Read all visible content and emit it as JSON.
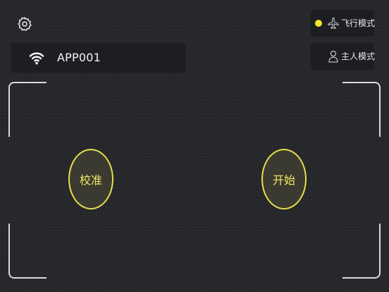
{
  "colors": {
    "background": "#27282b",
    "panel": "#1d1e21",
    "accent_yellow": "#e6e04a",
    "button_text": "#f3e866",
    "frame": "#d9dadc"
  },
  "settings": {
    "icon": "gear-icon"
  },
  "connection": {
    "icon": "wifi-icon",
    "ssid": "APP001"
  },
  "modes": [
    {
      "label": "飞行模式",
      "icon": "airplane-icon",
      "selected": true,
      "indicator_color": "#f2e62d"
    },
    {
      "label": "主人模式",
      "icon": "person-icon",
      "selected": false
    }
  ],
  "controls": {
    "calibrate_label": "校准",
    "start_label": "开始"
  }
}
